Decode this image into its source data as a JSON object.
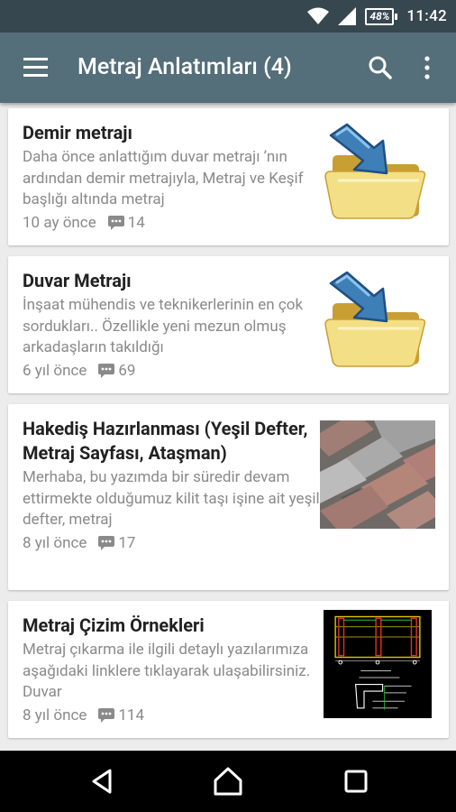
{
  "status_bar": {
    "battery": "48%",
    "time": "11:42"
  },
  "app_bar": {
    "title": "Metraj Anlatımları (4)"
  },
  "articles": [
    {
      "title": "Demir metrajı",
      "excerpt": "Daha önce anlattığım duvar metrajı ’nın ardından demir metrajıyla, Metraj ve Keşif başlığı altında metraj",
      "time": "10 ay önce",
      "comments": "14",
      "thumb": "folder-icon"
    },
    {
      "title": "Duvar Metrajı",
      "excerpt": "İnşaat mühendis ve teknikerlerinin en çok sordukları.. Özellikle yeni mezun olmuş arkadaşların takıldığı",
      "time": "6 yıl önce",
      "comments": "69",
      "thumb": "folder-icon"
    },
    {
      "title": "Hakediş Hazırlanması (Yeşil Defter, Metraj Sayfası, Ataşman)",
      "excerpt": "Merhaba, bu yazımda bir süredir devam ettirmekte olduğumuz kilit taşı işine ait yeşil defter, metraj",
      "time": "8 yıl önce",
      "comments": "17",
      "thumb": "paving-stones"
    },
    {
      "title": "Metraj Çizim Örnekleri",
      "excerpt": "Metraj çıkarma ile ilgili detaylı yazılarımıza aşağıdaki linklere tıklayarak ulaşabilirsiniz. Duvar",
      "time": "8 yıl önce",
      "comments": "114",
      "thumb": "cad-drawing"
    }
  ],
  "colors": {
    "status_bar": "#37474f",
    "app_bar": "#546e7a",
    "background": "#ececec",
    "title_text": "#212121",
    "secondary_text": "#8a8a8a"
  }
}
